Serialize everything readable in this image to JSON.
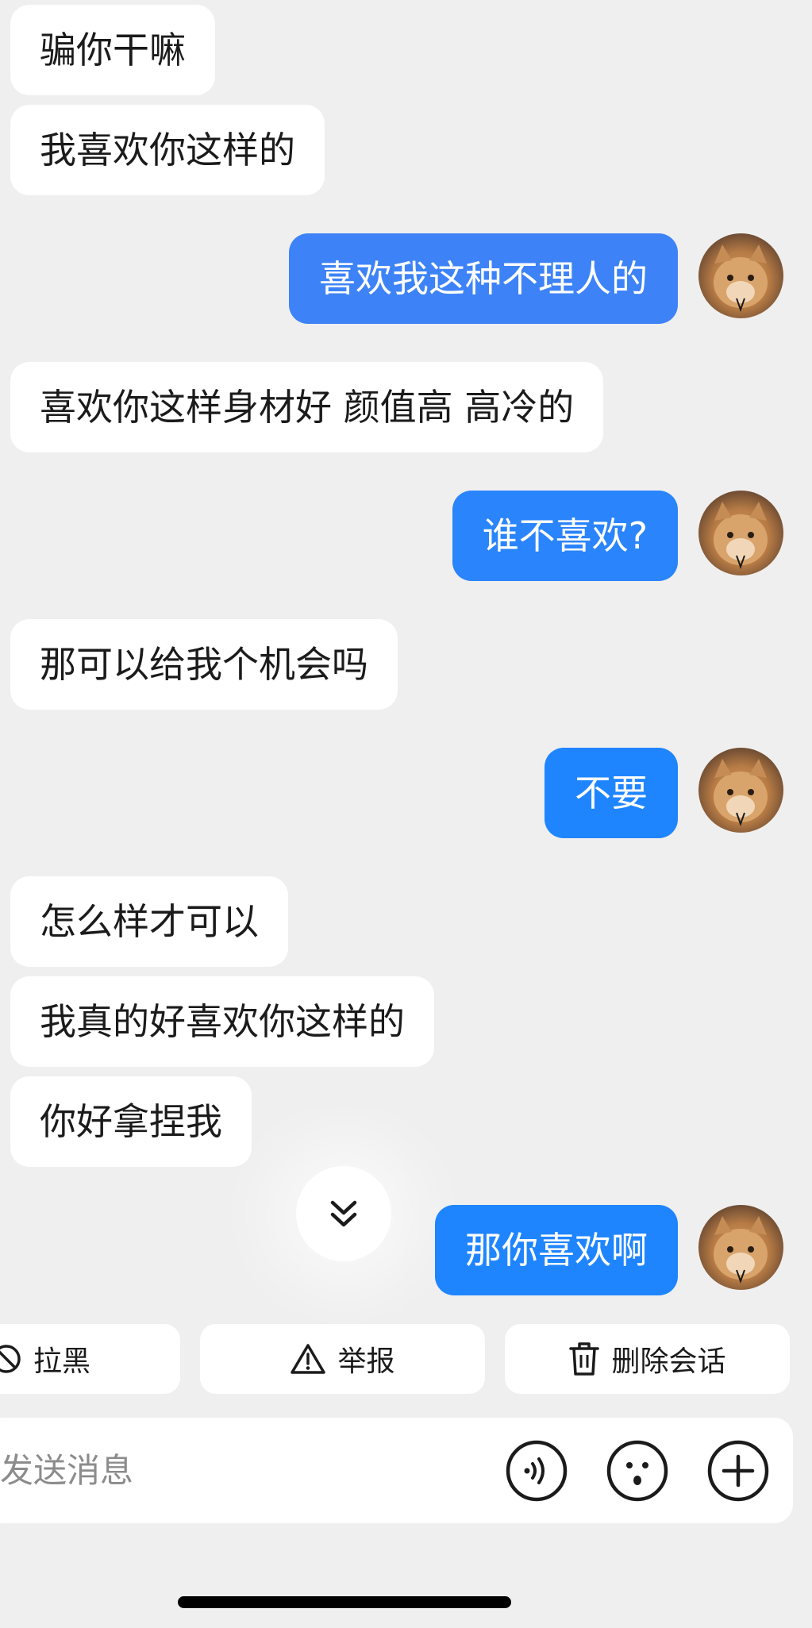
{
  "colors": {
    "background": "#efefef",
    "incoming_bubble": "#ffffff",
    "outgoing_bubble_gradient_start": "#3d83f7",
    "outgoing_bubble_solid": "#1f85ff",
    "text": "#1b1b1b"
  },
  "messages": [
    {
      "side": "incoming",
      "text": "骗你干嘛"
    },
    {
      "side": "incoming",
      "text": "我喜欢你这样的"
    },
    {
      "side": "outgoing",
      "text": "喜欢我这种不理人的",
      "avatar": "cat-avatar"
    },
    {
      "side": "incoming",
      "text": "喜欢你这样身材好 颜值高 高冷的"
    },
    {
      "side": "outgoing",
      "text": "谁不喜欢?",
      "avatar": "cat-avatar"
    },
    {
      "side": "incoming",
      "text": "那可以给我个机会吗"
    },
    {
      "side": "outgoing",
      "text": "不要",
      "avatar": "cat-avatar"
    },
    {
      "side": "incoming",
      "text": "怎么样才可以"
    },
    {
      "side": "incoming",
      "text": "我真的好喜欢你这样的"
    },
    {
      "side": "incoming",
      "text": "你好拿捏我"
    },
    {
      "side": "outgoing",
      "text": "那你喜欢啊",
      "avatar": "cat-avatar"
    }
  ],
  "scroll_button": {
    "icon": "double-chevron-down-icon"
  },
  "actions": {
    "block": {
      "label": "拉黑",
      "icon": "block-icon"
    },
    "report": {
      "label": "举报",
      "icon": "warning-icon"
    },
    "delete": {
      "label": "删除会话",
      "icon": "trash-icon"
    }
  },
  "composer": {
    "placeholder": "发送消息",
    "value": "",
    "buttons": [
      "voice-icon",
      "emoji-icon",
      "plus-icon"
    ]
  }
}
